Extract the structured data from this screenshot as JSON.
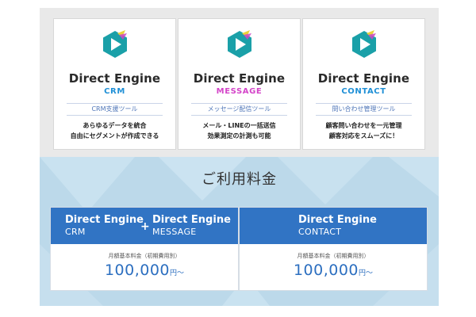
{
  "products": [
    {
      "brand": "Direct Engine",
      "sub": "CRM",
      "sub_color": "#1e8fd6",
      "category": "CRM支援ツール",
      "desc_line1": "あらゆるデータを統合",
      "desc_line2": "自由にセグメントが作成できる",
      "logo_icon": "direct-engine-play-logo"
    },
    {
      "brand": "Direct Engine",
      "sub": "MESSAGE",
      "sub_color": "#d445c9",
      "category": "メッセージ配信ツール",
      "desc_line1": "メール・LINEの一括送信",
      "desc_line2": "効果測定の計測も可能",
      "logo_icon": "direct-engine-play-logo"
    },
    {
      "brand": "Direct Engine",
      "sub": "CONTACT",
      "sub_color": "#1e8fd6",
      "category": "問い合わせ管理ツール",
      "desc_line1": "顧客問い合わせを一元管理",
      "desc_line2": "顧客対応をスムーズに！",
      "logo_icon": "direct-engine-play-logo"
    }
  ],
  "pricing": {
    "title": "ご利用料金",
    "plans": [
      {
        "left_brand": "Direct Engine",
        "left_sub": "CRM",
        "plus": "+",
        "right_brand": "Direct Engine",
        "right_sub": "MESSAGE",
        "fee_label": "月額基本料金（初期費用別）",
        "amount": "100,000",
        "unit": "円〜"
      },
      {
        "brand": "Direct Engine",
        "sub": "CONTACT",
        "fee_label": "月額基本料金（初期費用別）",
        "amount": "100,000",
        "unit": "円〜"
      }
    ]
  },
  "colors": {
    "accent_blue": "#3174c4",
    "logo_teal": "#1aa0a8",
    "logo_yellow": "#e9d23a",
    "logo_magenta": "#c946c4"
  }
}
